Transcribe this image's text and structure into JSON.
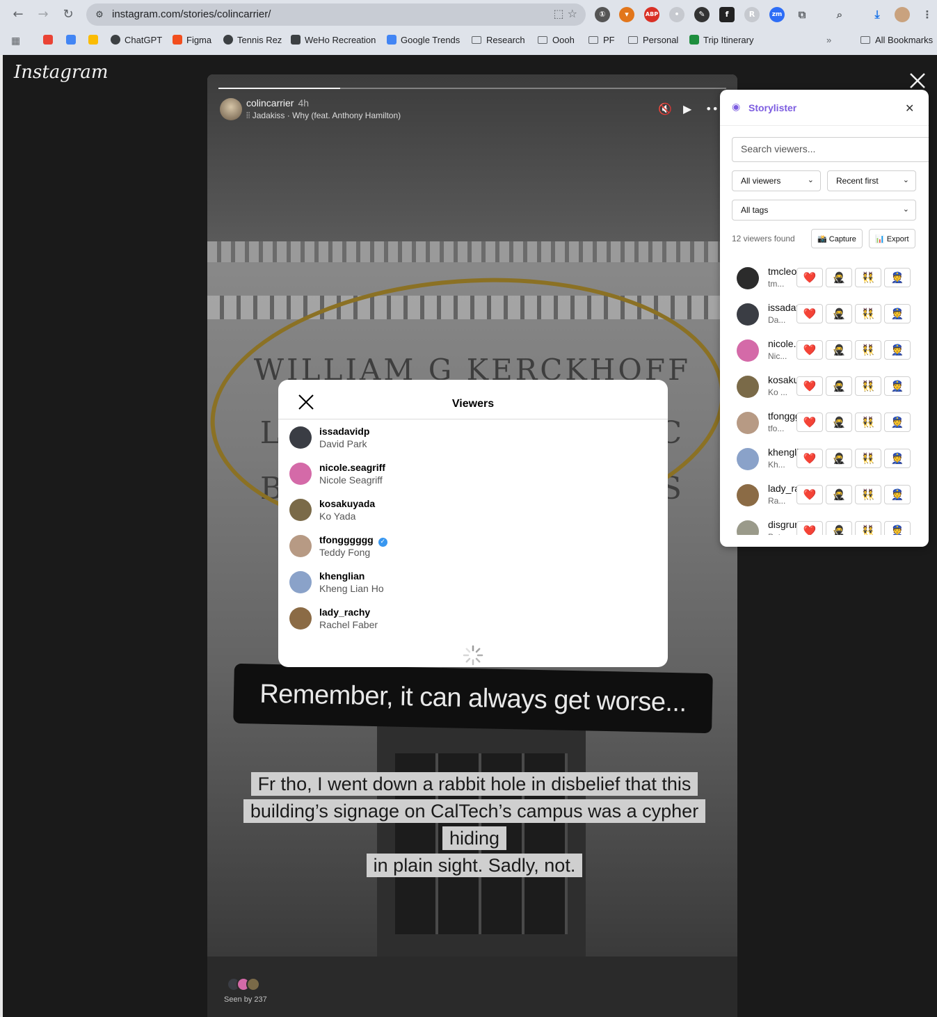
{
  "browser": {
    "url": "instagram.com/stories/colincarrier/",
    "bookmarks": [
      {
        "label": "",
        "color": "#ea4335"
      },
      {
        "label": "",
        "color": "#4285f4"
      },
      {
        "label": "",
        "color": "#fbbc04"
      },
      {
        "label": "ChatGPT",
        "color": "#3c4043"
      },
      {
        "label": "Figma",
        "color": "#f24e1e"
      },
      {
        "label": "Tennis Rez",
        "color": "#3c4043"
      },
      {
        "label": "WeHo Recreation",
        "color": "#3c4043"
      },
      {
        "label": "Google Trends",
        "color": "#4285f4"
      },
      {
        "label": "Research",
        "folder": true
      },
      {
        "label": "Oooh",
        "folder": true
      },
      {
        "label": "PF",
        "folder": true
      },
      {
        "label": "Personal",
        "folder": true
      },
      {
        "label": "Trip Itinerary",
        "color": "#1e8e3e"
      }
    ],
    "all_bookmarks": "All Bookmarks"
  },
  "instagram": {
    "logo": "Instagram",
    "story": {
      "username": "colincarrier",
      "time": "4h",
      "music": "Jadakiss · Why (feat. Anthony Hamilton)",
      "progress": 0.24,
      "engraving": [
        "WILLIAM G KERCKHOFF",
        "L                              C",
        "B                              S"
      ],
      "caption_main": "Remember, it can always get worse...",
      "caption_lines": [
        "Fr tho, I went down a rabbit hole in disbelief that this",
        "building’s signage on CalTech’s campus was a cypher hiding",
        "in plain sight.  Sadly, not."
      ],
      "seen_by": "Seen by 237"
    }
  },
  "viewers_modal": {
    "title": "Viewers",
    "viewers": [
      {
        "username": "issadavidp",
        "name": "David Park",
        "verified": false,
        "avatar": "#3a3d44"
      },
      {
        "username": "nicole.seagriff",
        "name": "Nicole Seagriff",
        "verified": false,
        "avatar": "#d46aa8"
      },
      {
        "username": "kosakuyada",
        "name": "Ko Yada",
        "verified": false,
        "avatar": "#7a6a48"
      },
      {
        "username": "tfongggggg",
        "name": "Teddy Fong",
        "verified": true,
        "avatar": "#b79a84"
      },
      {
        "username": "khenglian",
        "name": "Kheng Lian Ho",
        "verified": false,
        "avatar": "#8aa2c9"
      },
      {
        "username": "lady_rachy",
        "name": "Rachel Faber",
        "verified": false,
        "avatar": "#8b6b45"
      }
    ]
  },
  "storylister": {
    "title": "Storylister",
    "search_placeholder": "Search viewers...",
    "filter_viewers": "All viewers",
    "sort": "Recent first",
    "filter_tags": "All tags",
    "count_text": "12 viewers found",
    "capture_label": "📸 Capture",
    "export_label": "📊 Export",
    "tag_icons": [
      "❤️",
      "🥷",
      "👯",
      "👮"
    ],
    "rows": [
      {
        "user": "tmcleod",
        "name": "tm...",
        "avatar": "#2b2b2b"
      },
      {
        "user": "issadavidp",
        "name": "Da...",
        "avatar": "#3a3d44"
      },
      {
        "user": "nicole.seagriff",
        "name": "Nic...",
        "avatar": "#d46aa8"
      },
      {
        "user": "kosakuyada",
        "name": "Ko ...",
        "avatar": "#7a6a48"
      },
      {
        "user": "tfongggggg",
        "name": "tfo...",
        "avatar": "#b79a84"
      },
      {
        "user": "khenglian",
        "name": "Kh...",
        "avatar": "#8aa2c9"
      },
      {
        "user": "lady_rachy",
        "name": "Ra...",
        "avatar": "#8b6b45"
      },
      {
        "user": "disgruntled",
        "name": "Pet",
        "avatar": "#9a9a8a"
      }
    ]
  }
}
